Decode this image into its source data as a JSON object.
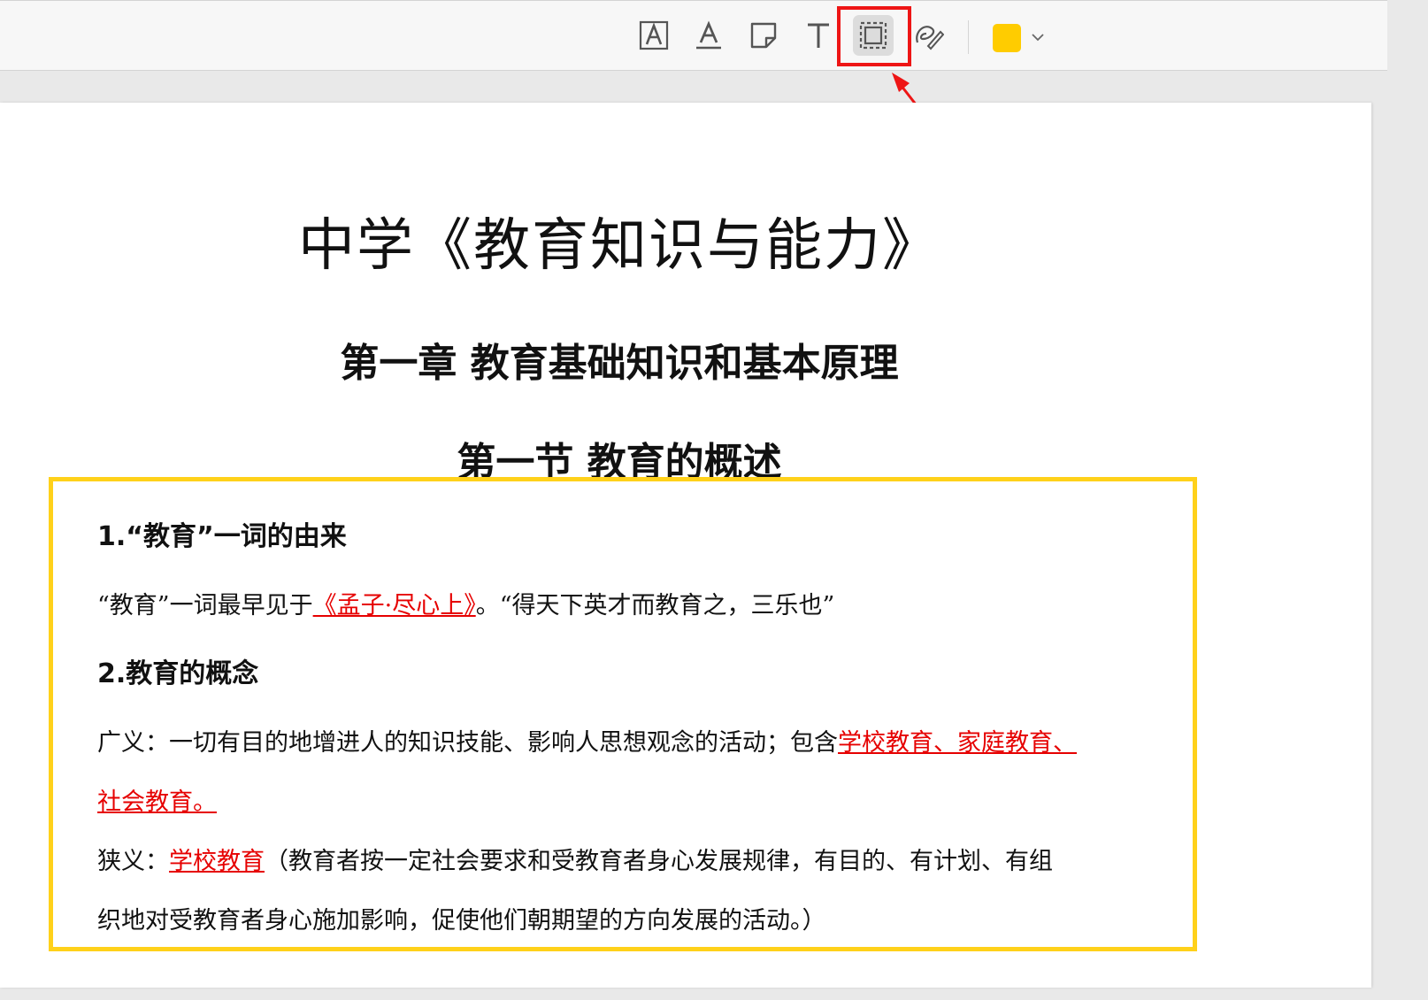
{
  "toolbar": {
    "tools": [
      {
        "name": "text-box-tool",
        "icon": "boxed-a-icon"
      },
      {
        "name": "underline-text-tool",
        "icon": "underlined-a-icon"
      },
      {
        "name": "note-tool",
        "icon": "sticky-note-icon"
      },
      {
        "name": "text-tool",
        "icon": "t-icon"
      },
      {
        "name": "area-select-tool",
        "icon": "area-select-icon",
        "selected": true
      },
      {
        "name": "signature-tool",
        "icon": "signature-icon"
      }
    ],
    "color": "#ffcc00"
  },
  "document": {
    "title": "中学《教育知识与能力》",
    "chapter": "第一章 教育基础知识和基本原理",
    "section": "第一节 教育的概述",
    "q1_heading": "1.“教育”一词的由来",
    "q1_text_a": "“教育”一词最早见于",
    "q1_text_red": "《孟子·尽心上》",
    "q1_text_b": "。“得天下英才而教育之，三乐也”",
    "q2_heading": "2.教育的概念",
    "broad_a": "广义：一切有目的地增进人的知识技能、影响人思想观念的活动；包含",
    "broad_red": "学校教育、家庭教育、",
    "broad_red2": "社会教育。",
    "narrow_label": "狭义：",
    "narrow_red": "学校教育",
    "narrow_b": "（教育者按一定社会要求和受教育者身心发展规律，有目的、有计划、有组",
    "narrow_c": "织地对受教育者身心施加影响，促使他们朝期望的方向发展的活动。）"
  },
  "colors": {
    "highlight_red": "#ee1515",
    "selection_yellow": "#ffd11a",
    "link_red": "#e60000"
  }
}
